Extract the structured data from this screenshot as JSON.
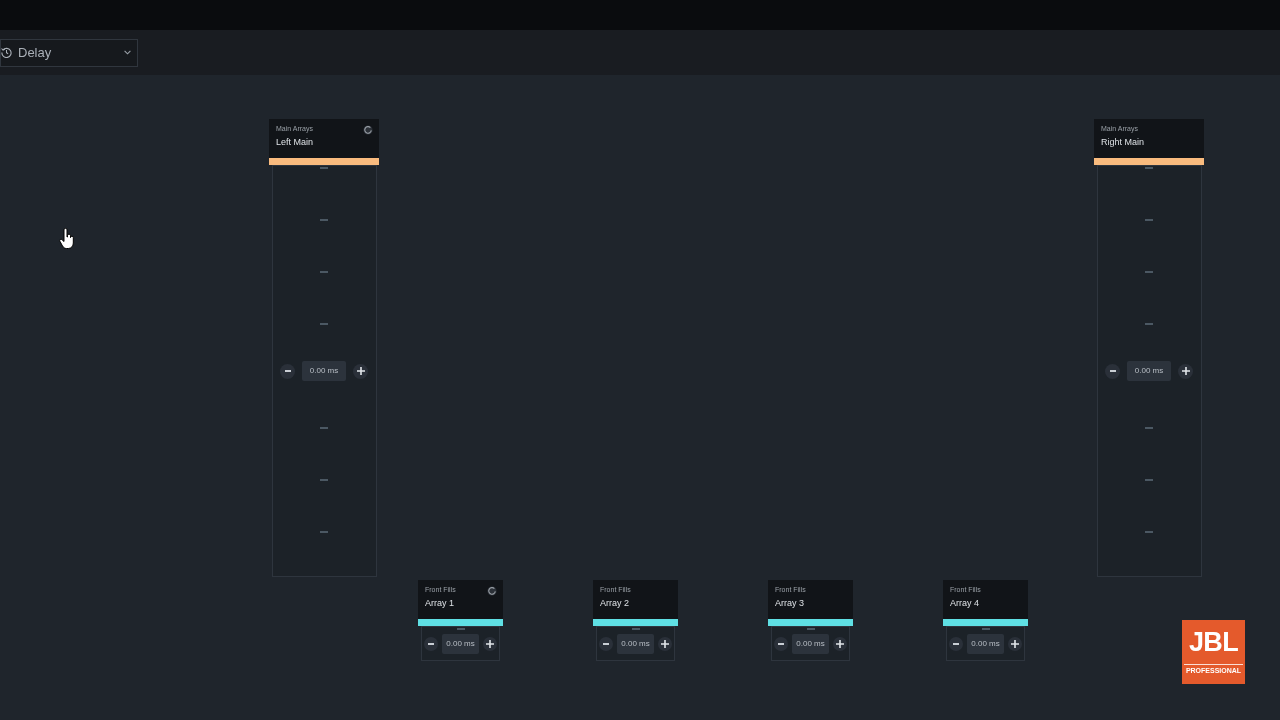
{
  "toolbar": {
    "view_dropdown": {
      "value": "Delay"
    }
  },
  "main_arrays": [
    {
      "group": "Main Arrays",
      "name": "Left Main",
      "color": "#f9bb7e",
      "delay": "0.00 ms",
      "dial": true
    },
    {
      "group": "Main Arrays",
      "name": "Right Main",
      "color": "#f9bb7e",
      "delay": "0.00 ms",
      "dial": false
    }
  ],
  "front_fills": [
    {
      "group": "Front Fills",
      "name": "Array 1",
      "color": "#5fe0e4",
      "delay": "0.00 ms",
      "dial": true
    },
    {
      "group": "Front Fills",
      "name": "Array 2",
      "color": "#5fe0e4",
      "delay": "0.00 ms",
      "dial": false
    },
    {
      "group": "Front Fills",
      "name": "Array 3",
      "color": "#5fe0e4",
      "delay": "0.00 ms",
      "dial": false
    },
    {
      "group": "Front Fills",
      "name": "Array 4",
      "color": "#5fe0e4",
      "delay": "0.00 ms",
      "dial": false
    }
  ],
  "logo": {
    "wordmark": "JBL",
    "tagline": "PROFESSIONAL"
  }
}
